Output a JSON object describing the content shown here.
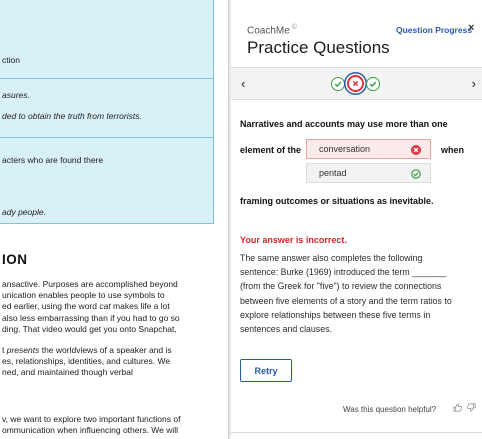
{
  "left_pane": {
    "table_cells": [
      "ction",
      "asures.",
      "ded to obtain the truth from terrorists.",
      "acters who are found there",
      "ady people."
    ],
    "heading": "ION",
    "paragraph1": [
      "ansactive. Purposes are accomplished beyond",
      "unication enables people to use symbols to",
      "ed earlier, using the word cat makes life a lot",
      "also less embarrassing than if you had to go so",
      "ding. That video would get you onto Snapchat,"
    ],
    "paragraph2": [
      "t presents the worldviews of a speaker and is",
      "es, relationships, identities, and cultures. We",
      "ned, and maintained though verbal"
    ],
    "paragraph3": [
      "v, we want to explore two important functions of",
      "ommunication when influencing others. We will"
    ]
  },
  "panel": {
    "brand": "CoachMe",
    "brand_mark": "©",
    "question_progress": "Question Progress",
    "close": "×",
    "title": "Practice Questions",
    "nav_prev": "‹",
    "nav_next": "›",
    "question": {
      "line1": "Narratives and accounts may use more than one",
      "line2_before": "element of the",
      "line2_after": "when",
      "line3": "framing outcomes or situations as inevitable.",
      "selected_answer": "conversation",
      "correct_answer": "pentad"
    },
    "result_label": "Your answer is incorrect.",
    "feedback_lines": [
      "The same answer also completes the following",
      "sentence: Burke (1969) introduced the term _______",
      "(from the Greek for \"five\") to review the connections",
      "between five elements of a story and the term ratios to",
      "explore relationships between these five terms in",
      "sentences and clauses."
    ],
    "retry_label": "Retry",
    "helpful_label": "Was this question helpful?",
    "thumbs_up": "👍",
    "thumbs_down": "👎"
  },
  "colors": {
    "accent_blue": "#2a5aa8",
    "error_red": "#d6252e",
    "success_green": "#3a9e48",
    "callout_bg": "#d8f1f7"
  }
}
